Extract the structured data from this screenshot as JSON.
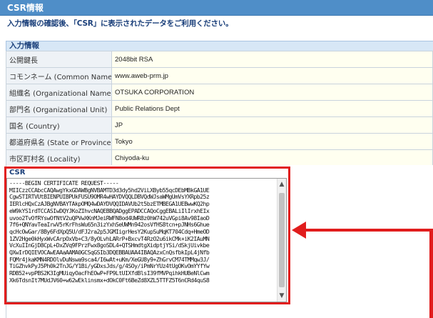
{
  "header": {
    "title": "CSR情報"
  },
  "instruction": "入力情報の確認後、「CSR」に表示されたデータをご利用ください。",
  "input_info": {
    "section_label": "入力情報",
    "rows": [
      {
        "label": "公開鍵長",
        "value": "2048bit RSA"
      },
      {
        "label": "コモンネーム (Common Name)",
        "value": "www.aweb-prm.jp"
      },
      {
        "label": "組織名 (Organizational Name)",
        "value": "OTSUKA CORPORATION"
      },
      {
        "label": "部門名 (Organizational Unit)",
        "value": "Public Relations Dept"
      },
      {
        "label": "国名 (Country)",
        "value": "JP"
      },
      {
        "label": "都道府県名 (State or Province)",
        "value": "Tokyo"
      },
      {
        "label": "市区町村名 (Locality)",
        "value": "Chiyoda-ku"
      }
    ]
  },
  "csr": {
    "label": "CSR",
    "text": "-----BEGIN CERTIFICATE REQUEST-----\nMIICzzCCAbcCAQAwgYkxGDAWBgNVBAMTD3d3dy5hd2ViLXByb55qcDEbMBkGA1UE\nCgwSTIRTVUtBIENPUIBPUkFUSU9OMR4wHAYDVQQLDBVQdWJsaWMgUmVsYXRpb25z\nIERlcHQxCzAJBgNVBAYTAkpOMQ4wDAYDVQQIDAVUb2t5bzETMBEGA1UEBwwKQ2hp\neW9kYS1rdTCCASIwDQYJKoZIhvcNAQEBBQADggEPADCCAQoCggEBALiIlIrxhEIx\nuvoo2TvOfRYswOfNtV2uQPVwXKnMJeiRWFN8od4UWR8z0hW742uVGpi8Av98IaoD\n7f6+QNYavTeaIrwV5rKrFhsWu65n3izYxhSeUWMn942osVfHS8tcn+pJNHs6Ghue\nqcHcOwGar/8By6FdXpQ5U/dFJ2ra2p5JGMIigrHesY2KupSuMqKT704Cdq+HmeOD\n1ZV2Hge0kHyxWvCArpOxVb+C3/8yOLvhLARrP+BxcvT4RzO2u6ikCMk+iK2IAuMN\nVcXuIInGjD8CpL+DxZVq9FPrzFwx8goSDL4+QTSHmdtgXidptjYSi/dSkjUivkbe\nQXwIrDQIEVOCAwEAAaAAMA0GCSqGSIb3DQEBBAUAA4IBAQAzxCnQsfbkIpL4jNfb\nFQMr4jkaKMN4RDOlvDuNswa9sca4/I6wAt+uKm/XeGU8y9+ZhGrvCM74TMMqw3J/\nTiGZhvkPyJ5Ph0k2TnJG/Y1Bi/yGDxsJds/g/4SOy/iPmNrYUz4tUgOKvOmYYfYw\nRDB52+vpPBS2K3IgMUiqyOacFhEOwP+FP9LtUIXfdBlsI39fMVPqihkHUBeNlCwm\nXk6TdsnIt7MUdJV60+w62wEklinsmx+dOkC0Ft6BeZd8XZL5TTFZ5T6nCRd4quS8"
  },
  "icons": {
    "scroll_up": "scroll-up-arrow-icon",
    "scroll_down": "scroll-down-arrow-icon"
  },
  "colors": {
    "header": "#4f8ec8",
    "highlight": "#e11d1d",
    "value_bg": "#fffff0",
    "label_bg": "#eef2f6"
  }
}
